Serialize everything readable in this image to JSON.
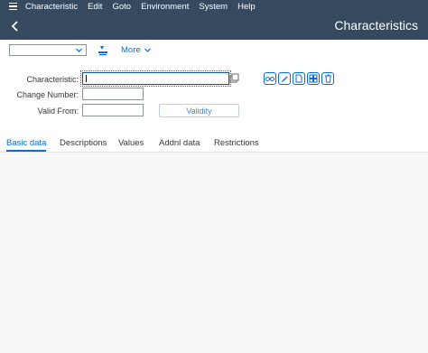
{
  "menu": {
    "items": [
      "Characteristic",
      "Edit",
      "Goto",
      "Environment",
      "System",
      "Help"
    ]
  },
  "header": {
    "title": "Characteristics"
  },
  "toolbar": {
    "dropdown_value": "",
    "more_label": "More"
  },
  "form": {
    "characteristic_label": "Characteristic:",
    "characteristic_value": "",
    "change_number_label": "Change Number:",
    "change_number_value": "",
    "valid_from_label": "Valid From:",
    "valid_from_value": "",
    "validity_button": "Validity"
  },
  "tabs": [
    "Basic data",
    "Descriptions",
    "Values",
    "Addnl data",
    "Restrictions"
  ],
  "colors": {
    "shell": "#354a5f",
    "accent": "#0a6ed1",
    "background": "#f7f7f7"
  }
}
